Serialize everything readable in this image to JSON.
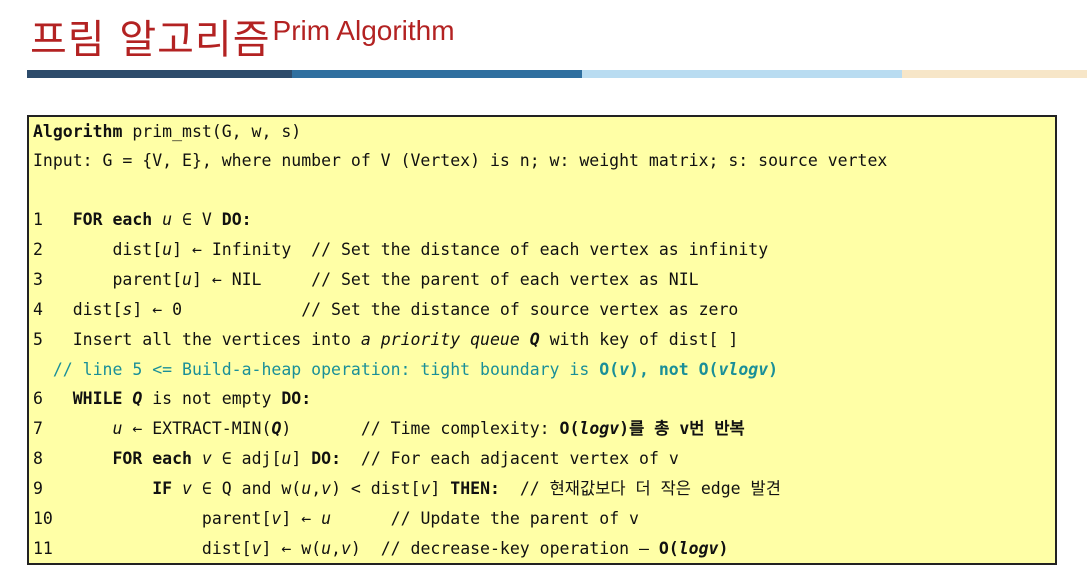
{
  "title": {
    "korean": "프림 알고리즘",
    "english": "Prim Algorithm"
  },
  "colors": {
    "title": "#b32222",
    "box_bg": "#ffffa6",
    "comment": "#1a8f98",
    "bar_dark": "#2d4b6b",
    "bar_mid": "#2f6f9f",
    "bar_light": "#b9dcf1",
    "bar_beige": "#f7e6c8"
  },
  "algorithm": {
    "header": {
      "keyword": "Algorithm",
      "signature": " prim_mst(G, w, s)"
    },
    "input": "Input: G = {V, E}, where number of V (Vertex) is n; w: weight matrix; s: source vertex",
    "lines": [
      {
        "num": "1",
        "segs": [
          {
            "t": "  "
          },
          {
            "t": "FOR each",
            "b": 1
          },
          {
            "t": " "
          },
          {
            "t": "u",
            "i": 1
          },
          {
            "t": " ∈ V "
          },
          {
            "t": "DO:",
            "b": 1
          }
        ]
      },
      {
        "num": "2",
        "segs": [
          {
            "t": "      dist["
          },
          {
            "t": "u",
            "i": 1
          },
          {
            "t": "] ← Infinity  // Set the distance of each vertex as infinity"
          }
        ]
      },
      {
        "num": "3",
        "segs": [
          {
            "t": "      parent["
          },
          {
            "t": "u",
            "i": 1
          },
          {
            "t": "] ← NIL     // Set the parent of each vertex as NIL"
          }
        ]
      },
      {
        "num": "4",
        "segs": [
          {
            "t": "  dist["
          },
          {
            "t": "s",
            "i": 1
          },
          {
            "t": "] ← 0            // Set the distance of source vertex as zero"
          }
        ]
      },
      {
        "num": "5",
        "segs": [
          {
            "t": "  Insert all the vertices into "
          },
          {
            "t": "a priority queue",
            "i": 1
          },
          {
            "t": " "
          },
          {
            "t": "Q",
            "b": 1,
            "i": 1
          },
          {
            "t": " with key of dist[ ]"
          }
        ]
      },
      {
        "num": "",
        "comment": 1,
        "segs": [
          {
            "t": "  // line 5 <= Build-a-heap operation: tight boundary is "
          },
          {
            "t": "O(",
            "b": 1
          },
          {
            "t": "v",
            "b": 1,
            "i": 1
          },
          {
            "t": "), not O(",
            "b": 1
          },
          {
            "t": "vlogv",
            "b": 1,
            "i": 1
          },
          {
            "t": ")",
            "b": 1
          }
        ]
      },
      {
        "num": "6",
        "segs": [
          {
            "t": "  "
          },
          {
            "t": "WHILE",
            "b": 1
          },
          {
            "t": " "
          },
          {
            "t": "Q",
            "b": 1,
            "i": 1
          },
          {
            "t": " is not empty "
          },
          {
            "t": "DO:",
            "b": 1
          }
        ]
      },
      {
        "num": "7",
        "segs": [
          {
            "t": "      "
          },
          {
            "t": "u",
            "i": 1
          },
          {
            "t": " ← EXTRACT-MIN("
          },
          {
            "t": "Q",
            "b": 1,
            "i": 1
          },
          {
            "t": ")       // Time complexity: "
          },
          {
            "t": "O(",
            "b": 1
          },
          {
            "t": "logv",
            "b": 1,
            "i": 1
          },
          {
            "t": ")를 총 v번 반복",
            "b": 1
          }
        ]
      },
      {
        "num": "8",
        "segs": [
          {
            "t": "      "
          },
          {
            "t": "FOR each",
            "b": 1
          },
          {
            "t": " "
          },
          {
            "t": "v",
            "i": 1
          },
          {
            "t": " ∈ adj["
          },
          {
            "t": "u",
            "i": 1
          },
          {
            "t": "] "
          },
          {
            "t": "DO:",
            "b": 1
          },
          {
            "t": "  // For each adjacent vertex of v"
          }
        ]
      },
      {
        "num": "9",
        "segs": [
          {
            "t": "          "
          },
          {
            "t": "IF",
            "b": 1
          },
          {
            "t": " "
          },
          {
            "t": "v",
            "i": 1
          },
          {
            "t": " ∈ Q and w("
          },
          {
            "t": "u",
            "i": 1
          },
          {
            "t": ","
          },
          {
            "t": "v",
            "i": 1
          },
          {
            "t": ") < dist["
          },
          {
            "t": "v",
            "i": 1
          },
          {
            "t": "] "
          },
          {
            "t": "THEN:",
            "b": 1
          },
          {
            "t": "  // 현재값보다 더 작은 edge 발견"
          }
        ]
      },
      {
        "num": "10",
        "segs": [
          {
            "t": "               parent["
          },
          {
            "t": "v",
            "i": 1
          },
          {
            "t": "] ← "
          },
          {
            "t": "u",
            "i": 1
          },
          {
            "t": "      // Update the parent of v"
          }
        ]
      },
      {
        "num": "11",
        "segs": [
          {
            "t": "               dist["
          },
          {
            "t": "v",
            "i": 1
          },
          {
            "t": "] ← w("
          },
          {
            "t": "u",
            "i": 1
          },
          {
            "t": ","
          },
          {
            "t": "v",
            "i": 1
          },
          {
            "t": ")  // decrease-key operation – "
          },
          {
            "t": "O(",
            "b": 1
          },
          {
            "t": "logv",
            "b": 1,
            "i": 1
          },
          {
            "t": ")",
            "b": 1
          }
        ]
      }
    ]
  }
}
